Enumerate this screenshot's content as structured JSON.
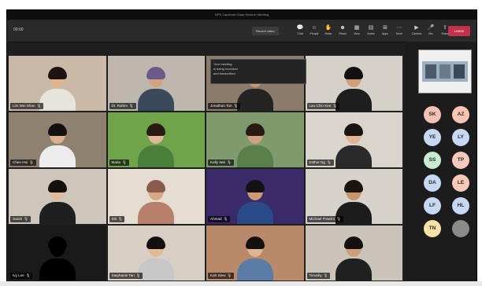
{
  "window": {
    "title": "NPS Capstone Class Session Meeting"
  },
  "toolbar": {
    "timer": "00:00",
    "record_label": "Record video",
    "buttons": [
      {
        "label": "Chat",
        "icon": "chat-icon"
      },
      {
        "label": "People",
        "icon": "people-icon"
      },
      {
        "label": "Raise",
        "icon": "hand-icon"
      },
      {
        "label": "React",
        "icon": "smile-icon"
      },
      {
        "label": "View",
        "icon": "grid-icon"
      },
      {
        "label": "Notes",
        "icon": "notes-icon"
      },
      {
        "label": "Apps",
        "icon": "apps-icon"
      },
      {
        "label": "More",
        "icon": "more-icon"
      },
      {
        "label": "Camera",
        "icon": "camera-icon"
      },
      {
        "label": "Mic",
        "icon": "mic-icon"
      },
      {
        "label": "Share",
        "icon": "share-icon"
      }
    ],
    "leave_label": "Leave"
  },
  "toast": {
    "lines": [
      "Your meeting",
      "is being recorded",
      "and transcribed"
    ]
  },
  "participants": [
    {
      "name": "Lim Wei Shan",
      "bg": "#c9b9a6",
      "skin": "#e2b48e",
      "hair": "#1c1410",
      "shirt": "#e7e4de"
    },
    {
      "name": "Dr. Rahim",
      "bg": "#bdb7ad",
      "skin": "#d3a47d",
      "hair": "#6a5a8a",
      "shirt": "#3b4a5a"
    },
    {
      "name": "Jonathan Tan",
      "bg": "#8b7b6a",
      "skin": "#c99771",
      "hair": "#1a1410",
      "shirt": "#242424"
    },
    {
      "name": "Lau Chin Kee",
      "bg": "#d5d0c8",
      "skin": "#cf9f7c",
      "hair": "#111111",
      "shirt": "#1e1e1e"
    },
    {
      "name": "Chen Hui",
      "bg": "#8f816f",
      "skin": "#dbb08c",
      "hair": "#141010",
      "shirt": "#ececec"
    },
    {
      "name": "Maria",
      "bg": "#6fa44b",
      "skin": "#e2b898",
      "hair": "#2a1a14",
      "shirt": "#4a7f3a"
    },
    {
      "name": "Kelly Wei",
      "bg": "#7f9b6e",
      "skin": "#cfa081",
      "hair": "#2a1a14",
      "shirt": "#5b7f4a"
    },
    {
      "name": "Esther Ng",
      "bg": "#d9d4cc",
      "skin": "#e0b592",
      "hair": "#1a1410",
      "shirt": "#2a2a2a"
    },
    {
      "name": "Sarah",
      "bg": "#cfc6bb",
      "skin": "#e3bb9a",
      "hair": "#141010",
      "shirt": "#1f1f1f"
    },
    {
      "name": "Siti",
      "bg": "#e6ddd2",
      "skin": "#d6a884",
      "hair": "#8a5a4a",
      "shirt": "#b8806a"
    },
    {
      "name": "Ahmad",
      "bg": "#3a2a6a",
      "skin": "#cf9a72",
      "hair": "#121212",
      "shirt": "#2a4a8a"
    },
    {
      "name": "Michael Prawiro",
      "bg": "#d7d2ca",
      "skin": "#c9946b",
      "hair": "#1a1410",
      "shirt": "#1c1c1c"
    },
    {
      "name": "Ivy Lee",
      "bg": "#1a1a1a",
      "skin": "#000000",
      "hair": "#000000",
      "shirt": "#000000"
    },
    {
      "name": "Stephanie Tan",
      "bg": "#d8cfc4",
      "skin": "#e4b996",
      "hair": "#141010",
      "shirt": "#c7c7c7"
    },
    {
      "name": "Kah Siew",
      "bg": "#b98a6a",
      "skin": "#e0b593",
      "hair": "#141010",
      "shirt": "#5a7da8"
    },
    {
      "name": "Timothy",
      "bg": "#cbc4ba",
      "skin": "#cf9f7a",
      "hair": "#141010",
      "shirt": "#202020"
    }
  ],
  "sidebar": {
    "avatars": [
      {
        "initials": "SK",
        "color": "#f2c2b4"
      },
      {
        "initials": "AZ",
        "color": "#f7c5b2"
      },
      {
        "initials": "YE",
        "color": "#c6d8f2"
      },
      {
        "initials": "LY",
        "color": "#c6d8f2"
      },
      {
        "initials": "SS",
        "color": "#c7ecd2"
      },
      {
        "initials": "TP",
        "color": "#f7c9b8"
      },
      {
        "initials": "DA",
        "color": "#c6d8f2"
      },
      {
        "initials": "LE",
        "color": "#f7c9b8"
      },
      {
        "initials": "LF",
        "color": "#c6d8f2"
      },
      {
        "initials": "HL",
        "color": "#c6d8f2"
      },
      {
        "initials": "TN",
        "color": "#f7e1a6"
      },
      {
        "initials": "",
        "color": "#8a8a8a"
      }
    ]
  }
}
